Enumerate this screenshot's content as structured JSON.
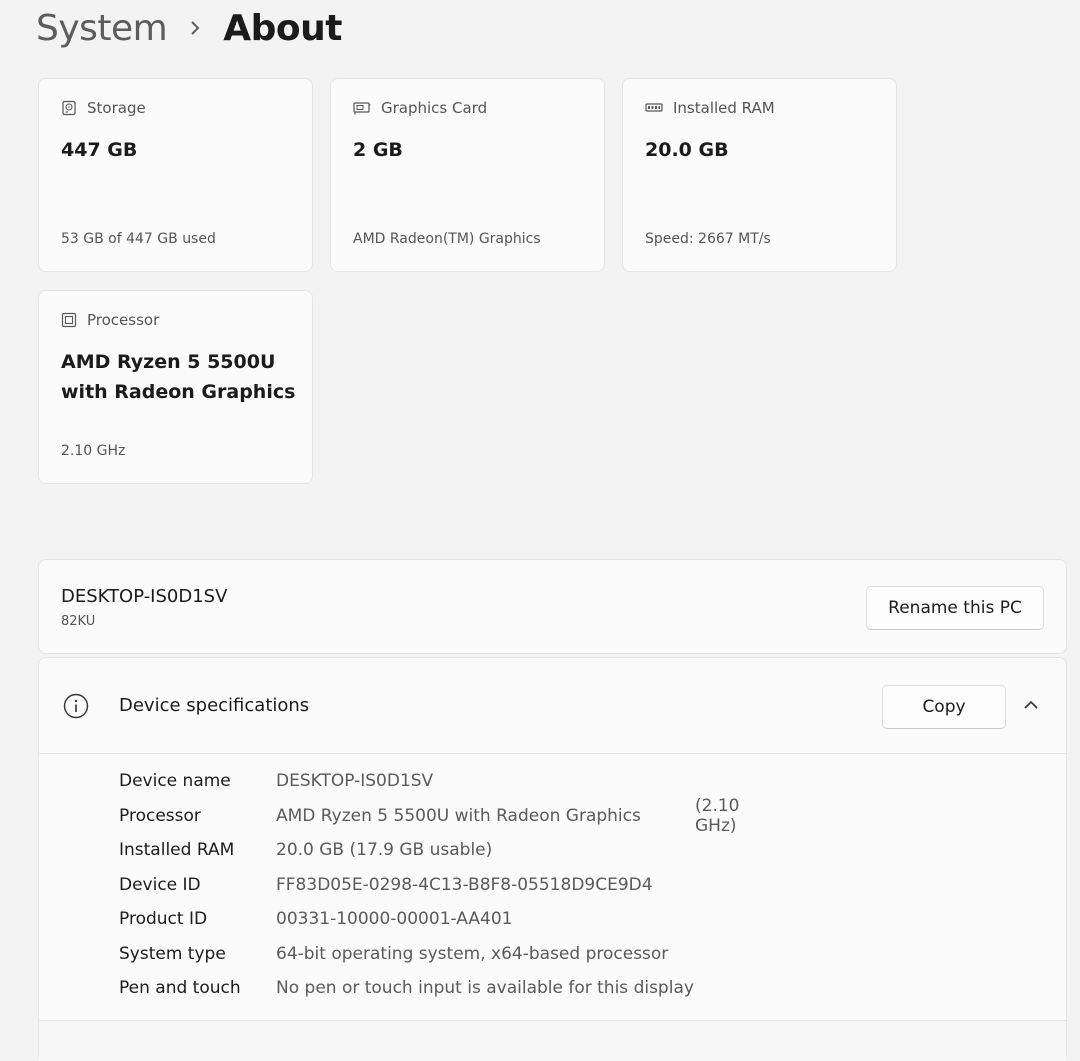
{
  "breadcrumb": {
    "parent": "System",
    "separator": "›",
    "current": "About"
  },
  "cards": {
    "storage": {
      "title": "Storage",
      "icon": "storage-icon",
      "value": "447 GB",
      "sub": "53 GB of 447 GB used"
    },
    "graphics": {
      "title": "Graphics Card",
      "icon": "graphics-card-icon",
      "value": "2 GB",
      "sub": "AMD Radeon(TM) Graphics"
    },
    "ram": {
      "title": "Installed RAM",
      "icon": "ram-icon",
      "value": "20.0 GB",
      "sub": "Speed: 2667 MT/s"
    },
    "processor": {
      "title": "Processor",
      "icon": "processor-icon",
      "value_line1": "AMD Ryzen 5 5500U",
      "value_line2": "with Radeon Graphics",
      "sub": "2.10 GHz"
    }
  },
  "device": {
    "name": "DESKTOP-IS0D1SV",
    "model": "82KU",
    "rename_label": "Rename this PC"
  },
  "specs": {
    "title": "Device specifications",
    "copy_label": "Copy",
    "rows": [
      {
        "label": "Device name",
        "value": "DESKTOP-IS0D1SV",
        "extra": ""
      },
      {
        "label": "Processor",
        "value": "AMD Ryzen 5 5500U with Radeon Graphics",
        "extra": "(2.10 GHz)"
      },
      {
        "label": "Installed RAM",
        "value": "20.0 GB (17.9 GB usable)",
        "extra": ""
      },
      {
        "label": "Device ID",
        "value": "FF83D05E-0298-4C13-B8F8-05518D9CE9D4",
        "extra": ""
      },
      {
        "label": "Product ID",
        "value": "00331-10000-00001-AA401",
        "extra": ""
      },
      {
        "label": "System type",
        "value": "64-bit operating system, x64-based processor",
        "extra": ""
      },
      {
        "label": "Pen and touch",
        "value": "No pen or touch input is available for this display",
        "extra": ""
      }
    ]
  },
  "colors": {
    "background": "#f3f3f3",
    "card": "#fbfbfb",
    "border": "#e5e5e5",
    "text_primary": "#1b1b1b",
    "text_secondary": "#5a5a5a"
  }
}
